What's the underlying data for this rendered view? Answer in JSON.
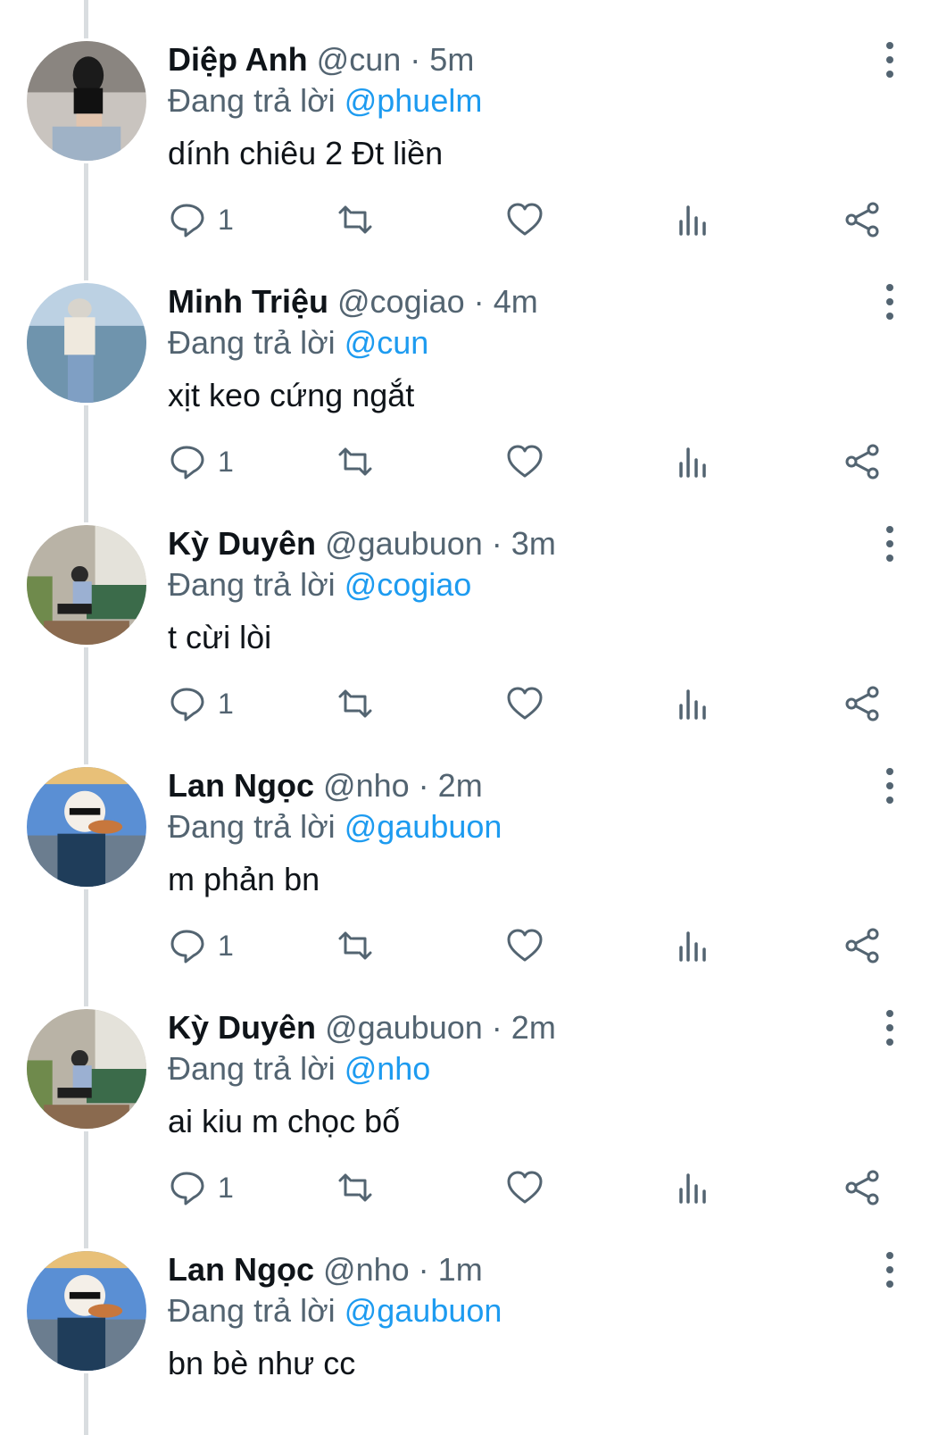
{
  "colors": {
    "text": "#0f1419",
    "secondary": "#536471",
    "mention": "#1d9bf0",
    "thread_line": "#d9dde0"
  },
  "icons": {
    "reply": "reply-icon",
    "retweet": "retweet-icon",
    "like": "heart-icon",
    "views": "analytics-icon",
    "share": "share-icon",
    "more": "more-vertical-icon"
  },
  "tweets": [
    {
      "name": "Diệp Anh",
      "handle": "@cun",
      "dot": "·",
      "time": "5m",
      "replying_prefix": "Đang trả lời",
      "replying_to": "@phuelm",
      "text": "dính chiêu 2 Đt liền",
      "reply_count": "1"
    },
    {
      "name": "Minh Triệu",
      "handle": "@cogiao",
      "dot": "·",
      "time": "4m",
      "replying_prefix": "Đang trả lời",
      "replying_to": "@cun",
      "text": "xịt keo cứng ngắt",
      "reply_count": "1"
    },
    {
      "name": "Kỳ Duyên",
      "handle": "@gaubuon",
      "dot": "·",
      "time": "3m",
      "replying_prefix": "Đang trả lời",
      "replying_to": "@cogiao",
      "text": "t cừi lòi",
      "reply_count": "1"
    },
    {
      "name": "Lan Ngọc",
      "handle": "@nho",
      "dot": "·",
      "time": "2m",
      "replying_prefix": "Đang trả lời",
      "replying_to": "@gaubuon",
      "text": "m phản bn",
      "reply_count": "1"
    },
    {
      "name": "Kỳ Duyên",
      "handle": "@gaubuon",
      "dot": "·",
      "time": "2m",
      "replying_prefix": "Đang trả lời",
      "replying_to": "@nho",
      "text": "ai kiu m chọc bố",
      "reply_count": "1"
    },
    {
      "name": "Lan Ngọc",
      "handle": "@nho",
      "dot": "·",
      "time": "1m",
      "replying_prefix": "Đang trả lời",
      "replying_to": "@gaubuon",
      "text": "bn bè như cc",
      "reply_count": ""
    }
  ]
}
